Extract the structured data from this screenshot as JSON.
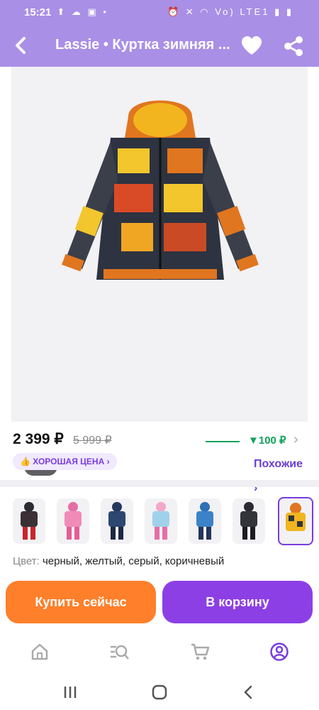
{
  "status_bar": {
    "time": "15:21",
    "left_icons": "⬆ ☁ ▣ •",
    "right_icons": "⏰ ✕ ◠ Vo) LTE1 ▮ ▮"
  },
  "app_bar": {
    "title": "Lassie • Куртка зимняя ..."
  },
  "gallery": {
    "counter": "1/10",
    "similar_label": "Похожие ›"
  },
  "price": {
    "current": "2 399 ₽",
    "old": "5 999 ₽",
    "bonus": "▼100 ₽",
    "chevron": "›",
    "badge": "👍 ХОРОШАЯ ЦЕНА ›"
  },
  "variants": [
    "kids-jacket-black",
    "kids-jacket-pink",
    "kids-jacket-navy",
    "kids-jacket-print-pink",
    "kids-jacket-blue",
    "kids-jacket-dark",
    "kids-jacket-yellow-print"
  ],
  "color": {
    "label": "Цвет:",
    "value": " черный, желтый, серый, коричневый"
  },
  "actions": {
    "buy_now": "Купить сейчас",
    "add_to_cart": "В корзину"
  },
  "tabs": [
    "home-icon",
    "catalog-search-icon",
    "cart-icon",
    "profile-icon"
  ],
  "colors": {
    "header": "#a98fe6",
    "buy": "#ff7f2a",
    "cart": "#8d3fe6",
    "accent": "#7a3ce0",
    "bonus": "#10a35a"
  }
}
